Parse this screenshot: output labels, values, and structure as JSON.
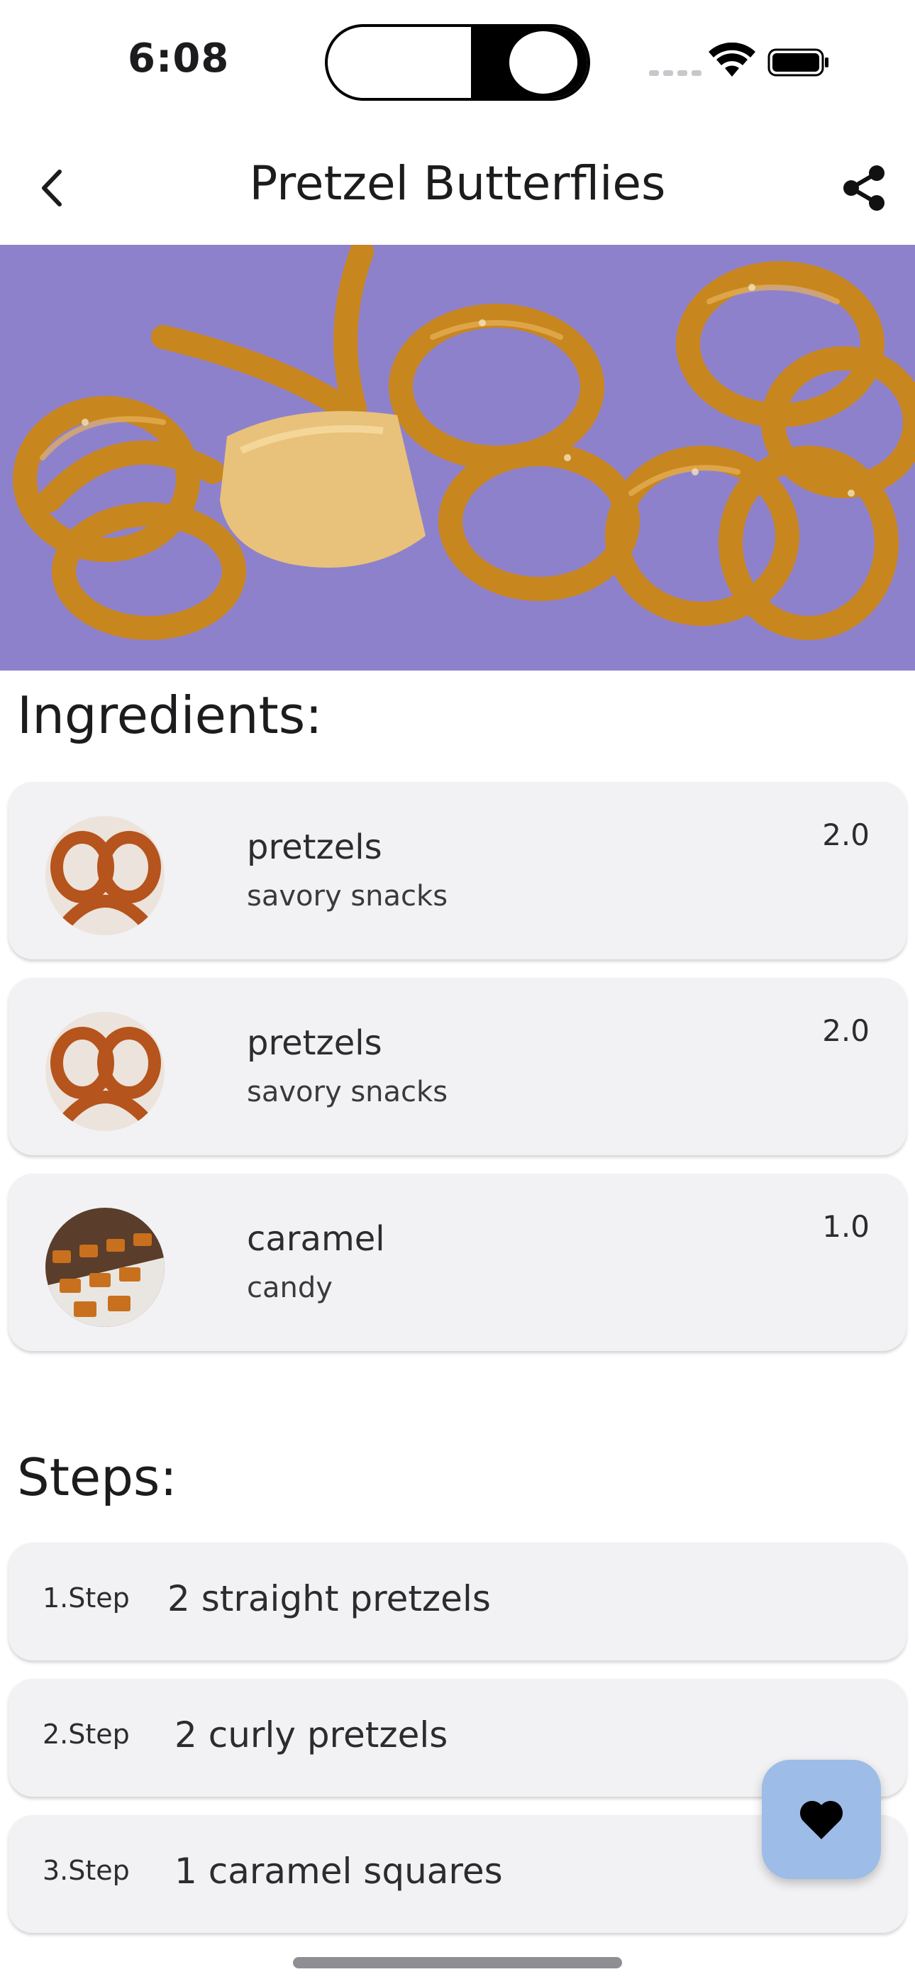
{
  "status_bar": {
    "time": "6:08",
    "icons": [
      "signal-icon",
      "wifi-icon",
      "battery-icon"
    ]
  },
  "header": {
    "title": "Pretzel Butterflies",
    "back_icon": "chevron-left-icon",
    "share_icon": "share-icon"
  },
  "ingredients": {
    "heading": "Ingredients:",
    "items": [
      {
        "name": "pretzels",
        "category": "savory snacks",
        "quantity": "2.0"
      },
      {
        "name": "pretzels",
        "category": "savory snacks",
        "quantity": "2.0"
      },
      {
        "name": "caramel",
        "category": "candy",
        "quantity": "1.0"
      }
    ]
  },
  "steps": {
    "heading": "Steps:",
    "items": [
      {
        "number": "1.Step",
        "text": "2 straight pretzels"
      },
      {
        "number": "2.Step",
        "text": "2 curly pretzels"
      },
      {
        "number": "3.Step",
        "text": "1 caramel squares"
      }
    ]
  },
  "favorite_button": {
    "icon": "heart-icon"
  },
  "colors": {
    "card_background": "#f2f2f4",
    "fab_background": "#9dbce8",
    "hero_background": "#8e81cc",
    "pretzel": "#c8861f"
  }
}
